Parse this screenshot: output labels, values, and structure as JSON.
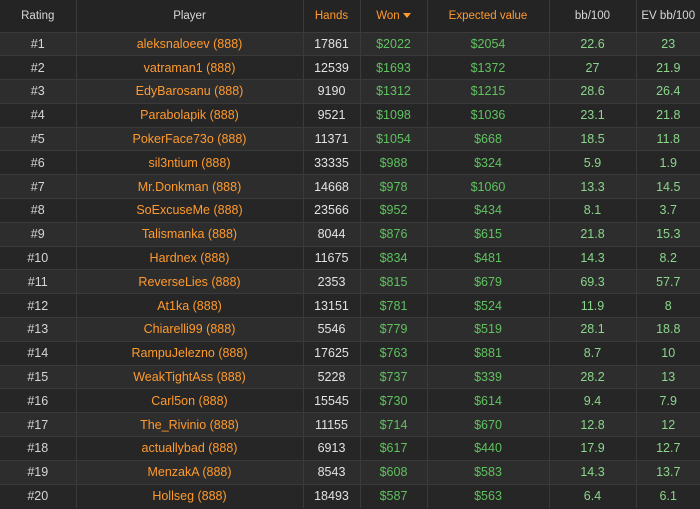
{
  "columns": {
    "rating": "Rating",
    "player": "Player",
    "hands": "Hands",
    "won": "Won",
    "expected_value": "Expected value",
    "bb100": "bb/100",
    "ev_bb100": "EV bb/100"
  },
  "colors": {
    "accent_orange": "#ff9a2e",
    "money_green": "#5fc25f",
    "rate_green": "#8ad68a",
    "background": "#232323"
  },
  "sort": {
    "column": "won",
    "direction": "desc",
    "icon": "caret-down-icon"
  },
  "rows": [
    {
      "rank": "#1",
      "player": "aleksnaloeev (888)",
      "hands": "17861",
      "won": "$2022",
      "ev": "$2054",
      "bb": "22.6",
      "evbb": "23"
    },
    {
      "rank": "#2",
      "player": "vatraman1 (888)",
      "hands": "12539",
      "won": "$1693",
      "ev": "$1372",
      "bb": "27",
      "evbb": "21.9"
    },
    {
      "rank": "#3",
      "player": "EdyBarosanu (888)",
      "hands": "9190",
      "won": "$1312",
      "ev": "$1215",
      "bb": "28.6",
      "evbb": "26.4"
    },
    {
      "rank": "#4",
      "player": "Parabolapik (888)",
      "hands": "9521",
      "won": "$1098",
      "ev": "$1036",
      "bb": "23.1",
      "evbb": "21.8"
    },
    {
      "rank": "#5",
      "player": "PokerFace73o (888)",
      "hands": "11371",
      "won": "$1054",
      "ev": "$668",
      "bb": "18.5",
      "evbb": "11.8"
    },
    {
      "rank": "#6",
      "player": "sil3ntium (888)",
      "hands": "33335",
      "won": "$988",
      "ev": "$324",
      "bb": "5.9",
      "evbb": "1.9"
    },
    {
      "rank": "#7",
      "player": "Mr.Donkman (888)",
      "hands": "14668",
      "won": "$978",
      "ev": "$1060",
      "bb": "13.3",
      "evbb": "14.5"
    },
    {
      "rank": "#8",
      "player": "SoExcuseMe (888)",
      "hands": "23566",
      "won": "$952",
      "ev": "$434",
      "bb": "8.1",
      "evbb": "3.7"
    },
    {
      "rank": "#9",
      "player": "Talismanka (888)",
      "hands": "8044",
      "won": "$876",
      "ev": "$615",
      "bb": "21.8",
      "evbb": "15.3"
    },
    {
      "rank": "#10",
      "player": "Hardnex (888)",
      "hands": "11675",
      "won": "$834",
      "ev": "$481",
      "bb": "14.3",
      "evbb": "8.2"
    },
    {
      "rank": "#11",
      "player": "ReverseLies (888)",
      "hands": "2353",
      "won": "$815",
      "ev": "$679",
      "bb": "69.3",
      "evbb": "57.7"
    },
    {
      "rank": "#12",
      "player": "At1ka (888)",
      "hands": "13151",
      "won": "$781",
      "ev": "$524",
      "bb": "11.9",
      "evbb": "8"
    },
    {
      "rank": "#13",
      "player": "Chiarelli99 (888)",
      "hands": "5546",
      "won": "$779",
      "ev": "$519",
      "bb": "28.1",
      "evbb": "18.8"
    },
    {
      "rank": "#14",
      "player": "RampuJelezno (888)",
      "hands": "17625",
      "won": "$763",
      "ev": "$881",
      "bb": "8.7",
      "evbb": "10"
    },
    {
      "rank": "#15",
      "player": "WeakTightAss (888)",
      "hands": "5228",
      "won": "$737",
      "ev": "$339",
      "bb": "28.2",
      "evbb": "13"
    },
    {
      "rank": "#16",
      "player": "Carl5on (888)",
      "hands": "15545",
      "won": "$730",
      "ev": "$614",
      "bb": "9.4",
      "evbb": "7.9"
    },
    {
      "rank": "#17",
      "player": "The_Rivinio (888)",
      "hands": "11155",
      "won": "$714",
      "ev": "$670",
      "bb": "12.8",
      "evbb": "12"
    },
    {
      "rank": "#18",
      "player": "actuallybad (888)",
      "hands": "6913",
      "won": "$617",
      "ev": "$440",
      "bb": "17.9",
      "evbb": "12.7"
    },
    {
      "rank": "#19",
      "player": "MenzakA (888)",
      "hands": "8543",
      "won": "$608",
      "ev": "$583",
      "bb": "14.3",
      "evbb": "13.7"
    },
    {
      "rank": "#20",
      "player": "Hollseg (888)",
      "hands": "18493",
      "won": "$587",
      "ev": "$563",
      "bb": "6.4",
      "evbb": "6.1"
    }
  ]
}
